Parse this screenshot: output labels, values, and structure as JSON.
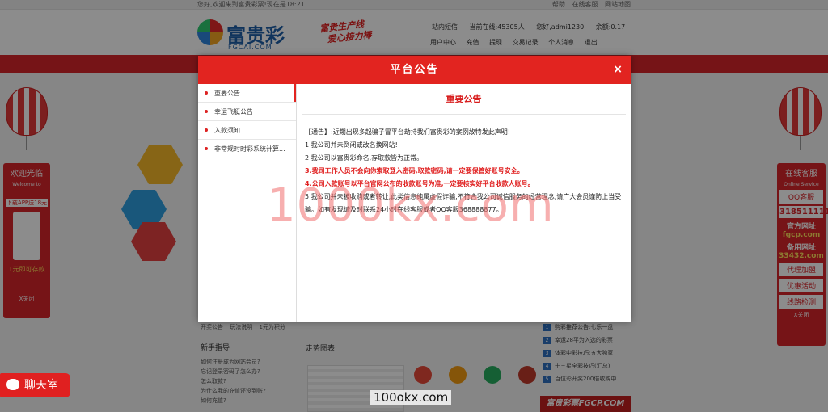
{
  "topbar": {
    "greeting": "您好,欢迎来到富贵彩票!现在是18:21",
    "links": [
      "帮助",
      "在线客服",
      "网站地图"
    ]
  },
  "logo": {
    "name": "富贵彩",
    "url": "FGCAI.COM"
  },
  "slogan": {
    "line1": "富贵生产线",
    "line2": "爱心接力棒"
  },
  "user": {
    "links_label": "站内短信",
    "online_label": "当前在线:",
    "online_count": "45305人",
    "hello_label": "您好,",
    "username": "admi1230",
    "balance_label": "余额:",
    "balance": "0.17"
  },
  "usermenu": [
    "用户中心",
    "充值",
    "提现",
    "交易记录",
    "个人消息",
    "退出"
  ],
  "left_side": {
    "welcome": "欢迎光临",
    "welcome_en": "Welcome to",
    "app_download": "下载APP送18元",
    "promo": "1元即可存款",
    "close": "X关闭"
  },
  "right_side": {
    "service": "在线客服",
    "service_en": "Online Service",
    "qq_service": "QQ客服",
    "qq_number": "318511111",
    "official_label": "官方网址",
    "official_url": "fgcp.com",
    "backup_label": "备用网址",
    "backup_url": "33432.com",
    "agent": "代理加盟",
    "promo": "优惠活动",
    "line_check": "线路检测",
    "close": "X关闭"
  },
  "bg_sections": {
    "newbie": "新手指导",
    "trend": "走势图表",
    "newbie_items": [
      "如何注册成为网站会员?",
      "忘记登录密码了怎么办?",
      "怎么取款?",
      "为什么我的充值还没到账?",
      "如何充值?"
    ],
    "tabs": [
      "开奖公告",
      "玩法说明",
      "1元为积分"
    ],
    "news": [
      {
        "num": "1",
        "text": "购彩推荐公告:七乐一盘"
      },
      {
        "num": "2",
        "text": "幸运28平为入选的彩票"
      },
      {
        "num": "3",
        "text": "体彩中彩技巧:五大独家"
      },
      {
        "num": "4",
        "text": "十三星全彩技巧(汇总)"
      },
      {
        "num": "5",
        "text": "百位彩开奖200倍收购中"
      }
    ],
    "bottom_banner": "富贵彩票FGCP.COM"
  },
  "chat_button": {
    "label": "聊天室"
  },
  "modal": {
    "title": "平台公告",
    "close": "×",
    "nav": [
      {
        "label": "重要公告",
        "active": true
      },
      {
        "label": "幸运飞艇公告",
        "active": false
      },
      {
        "label": "入款须知",
        "active": false
      },
      {
        "label": "非常规时时彩系统计算...",
        "active": false
      }
    ],
    "content_title": "重要公告",
    "lines": [
      {
        "text": "【通告】:近期出现多起骗子冒平台劫持我们富贵彩的案例故特发此声明!",
        "red": false
      },
      {
        "text": "1.我公司并未倒闭或改名换网站!",
        "red": false
      },
      {
        "text": "2.我公司以富贵彩命名,存取款皆为正常。",
        "red": false
      },
      {
        "text": "3.我司工作人员不会向你索取登入密码,取款密码,请一定要保管好账号安全。",
        "red": true
      },
      {
        "text": "4.公司入款账号以平台官网公布的收款账号为准,一定要核实好平台收款人账号。",
        "red": true
      },
      {
        "text": "5.我公司并未被收购或者转让,此类信息纯属虚假诈骗,不符合我公司诚信服务的经营理念,请广大会员谨防上当受骗。如有发现请及时联系24小时在线客服或者QQ客服368888877。",
        "red": false
      }
    ]
  },
  "watermark": {
    "text": "1000kx.com",
    "small": "100okx.com"
  }
}
